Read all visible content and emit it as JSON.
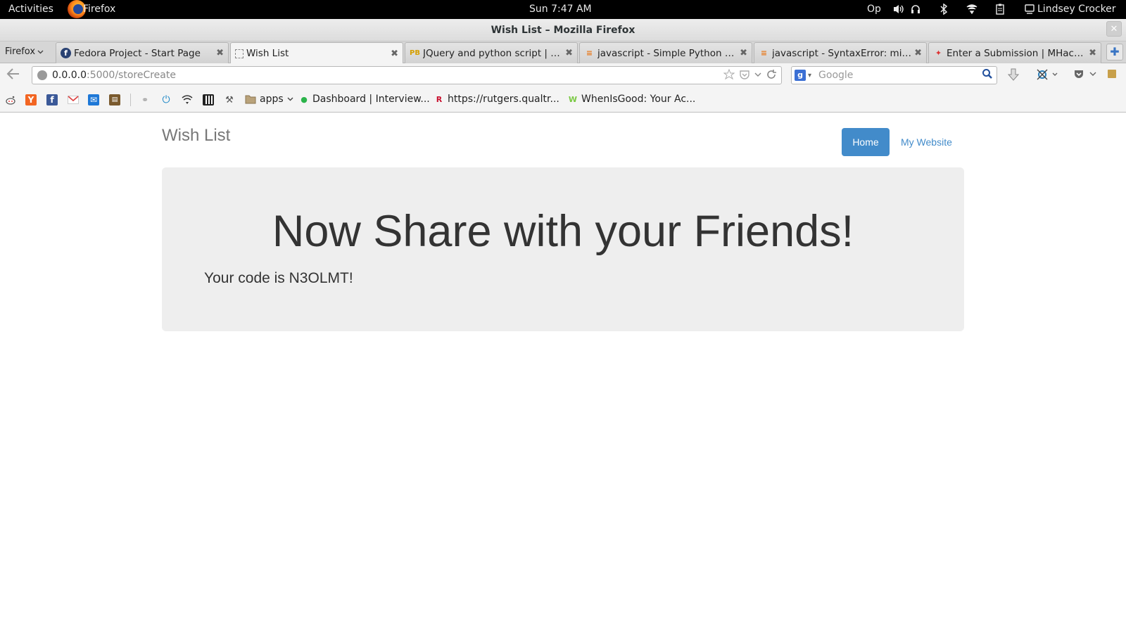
{
  "topbar": {
    "activities": "Activities",
    "app_name": "Firefox",
    "clock": "Sun  7:47 AM",
    "indicator": "Op",
    "user": "Lindsey Crocker",
    "tray_icons": [
      "volume-icon",
      "headphones-icon",
      "bluetooth-icon",
      "wifi-icon",
      "clipboard-icon"
    ]
  },
  "window": {
    "title": "Wish List – Mozilla Firefox",
    "close_glyph": "✕"
  },
  "tabstrip": {
    "menu_label": "Firefox",
    "tabs": [
      {
        "label": "Fedora Project - Start Page",
        "favicon": "f",
        "active": false
      },
      {
        "label": "Wish List",
        "favicon": "",
        "active": true
      },
      {
        "label": "JQuery and python script | p...",
        "favicon": "PB",
        "active": false
      },
      {
        "label": "javascript - Simple Python a...",
        "favicon": "≡",
        "active": false
      },
      {
        "label": "javascript - SyntaxError: mis...",
        "favicon": "≡",
        "active": false
      },
      {
        "label": "Enter a Submission | MHack...",
        "favicon": "✦",
        "active": false
      }
    ],
    "close_glyph": "✖",
    "new_tab_glyph": "✚"
  },
  "navbar": {
    "url_host": "0.0.0.0",
    "url_rest": ":5000/storeCreate",
    "search_placeholder": "Google",
    "search_engine_glyph": "g"
  },
  "bookmarks": {
    "folder_label": "apps",
    "items": [
      {
        "label": "Dashboard | Interview..."
      },
      {
        "label": "https://rutgers.qualtr..."
      },
      {
        "label": "WhenIsGood: Your Ac..."
      }
    ]
  },
  "page": {
    "brand": "Wish List",
    "nav": [
      {
        "label": "Home",
        "active": true
      },
      {
        "label": "My Website",
        "active": false
      }
    ],
    "heading": "Now Share with your Friends!",
    "code_text": "Your code is N3OLMT!"
  },
  "colors": {
    "accent": "#428bca",
    "jumbotron_bg": "#eeeeee",
    "topbar_bg": "#000000"
  }
}
